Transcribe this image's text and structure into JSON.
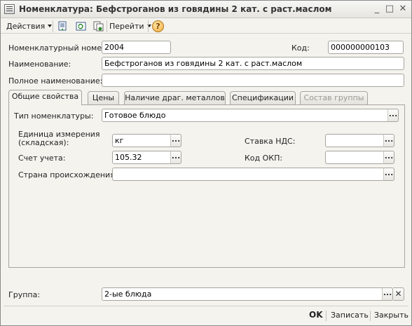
{
  "window": {
    "title": "Номенклатура: Бефстроганов из говядины 2 кат. с раст.маслом",
    "min_glyph": "_",
    "max_glyph": "□",
    "close_glyph": "✕"
  },
  "toolbar": {
    "actions_label": "Действия",
    "goto_label": "Перейти",
    "help_glyph": "?"
  },
  "form": {
    "nom_number": {
      "label": "Номенклатурный номер:",
      "value": "2004"
    },
    "code": {
      "label": "Код:",
      "value": "000000000103"
    },
    "name": {
      "label": "Наименование:",
      "value": "Бефстроганов из говядины 2 кат. с раст.маслом"
    },
    "full_name": {
      "label": "Полное наименование:",
      "value": ""
    }
  },
  "tabs": [
    {
      "label": "Общие свойства",
      "state": "active"
    },
    {
      "label": "Цены",
      "state": "normal"
    },
    {
      "label": "Наличие драг. металлов",
      "state": "normal"
    },
    {
      "label": "Спецификации",
      "state": "normal"
    },
    {
      "label": "Состав группы",
      "state": "disabled"
    }
  ],
  "general": {
    "type": {
      "label": "Тип номенклатуры:",
      "value": "Готовое блюдо"
    },
    "unit": {
      "label_line1": "Единица измерения",
      "label_line2": "(складская):",
      "value": "кг"
    },
    "vat": {
      "label": "Ставка НДС:",
      "value": ""
    },
    "account": {
      "label": "Счет учета:",
      "value": "105.32"
    },
    "okp": {
      "label": "Код ОКП:",
      "value": ""
    },
    "country": {
      "label": "Страна происхождения:",
      "value": ""
    }
  },
  "group": {
    "label": "Группа:",
    "value": "2-ые блюда"
  },
  "buttons": {
    "choose": "...",
    "clear": "✕"
  },
  "footer": {
    "ok": "OK",
    "write": "Записать",
    "close": "Закрыть"
  }
}
